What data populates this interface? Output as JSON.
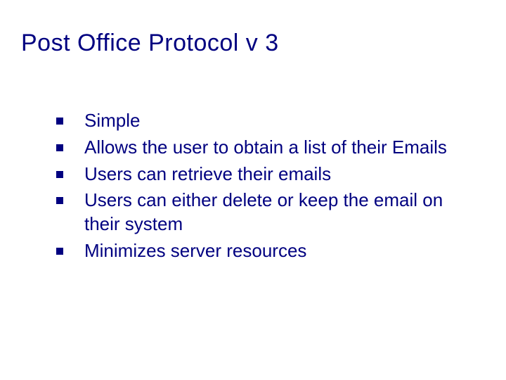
{
  "title": "Post Office Protocol v 3",
  "bullets": [
    "Simple",
    "Allows the user to obtain a list of their Emails",
    "Users can retrieve their emails",
    "Users can either delete or keep the email on their system",
    "Minimizes server resources"
  ]
}
